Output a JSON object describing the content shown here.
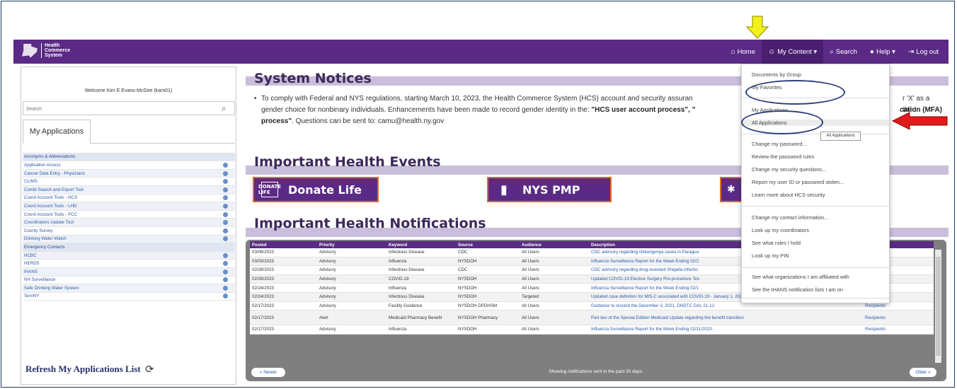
{
  "header": {
    "logo_text": "Health Commerce System",
    "nav": [
      {
        "icon": "home-icon",
        "label": "Home"
      },
      {
        "icon": "user-icon",
        "label": "My Content ▾"
      },
      {
        "icon": "search-icon",
        "label": "Search"
      },
      {
        "icon": "help-icon",
        "label": "Help ▾"
      },
      {
        "icon": "logout-icon",
        "label": "Log out"
      }
    ]
  },
  "sidebar": {
    "welcome": "Welcome Kim E Evans-McGee (kam01)",
    "search_placeholder": "Search",
    "tab_label": "My Applications",
    "apps": [
      "Acronyms & Abbreviations",
      "Application Access",
      "Cancer Data Entry - Physicians",
      "CLIMS",
      "Combi Search and Export Tool",
      "Coord Account Tools - HCS",
      "Coord Account Tools - LHD",
      "Coord Account Tools - PCC",
      "Coordinators Update Tool",
      "County Survey",
      "Drinking Water Watch",
      "Emergency Contacts",
      "HCBC",
      "HERDS",
      "IHANS",
      "NH Surveillance",
      "Safe Drinking Water System",
      "ServNY"
    ],
    "refresh_label": "Refresh My Applications List"
  },
  "main": {
    "system_notices_title": "System Notices",
    "notice_text_1": "To comply with Federal and NYS regulations, starting March 10, 2023, the Health Commerce System (HCS) account and security assuran",
    "notice_text_1b": "r 'X' as a third",
    "notice_text_2": "gender choice for nonbinary individuals. Enhancements have been made to record gender identity in the: ",
    "notice_bold_1": "\"HCS user account process\", \"",
    "notice_bold_2": "cation (MFA)",
    "notice_text_3_bold": "process\"",
    "notice_text_3": ". Questions can be sent to: camu@health.ny.gov",
    "health_events_title": "Important Health Events",
    "banners": [
      "Donate Life",
      "NYS PMP"
    ],
    "banner_icons": [
      "DONATE LIFE",
      "▮"
    ],
    "notifications_title": "Important Health Notifications",
    "table": {
      "columns": [
        "Posted",
        "Priority",
        "Keyword",
        "Source",
        "Audience",
        "Description",
        "nts"
      ],
      "rows": [
        [
          "03/06/2023",
          "Advisory",
          "Infectious Disease",
          "CDC",
          "All Users",
          "CDC advisory regarding chikungunya cases in Paragua",
          "nts"
        ],
        [
          "03/03/2023",
          "Advisory",
          "Influenza",
          "NYSDOH",
          "All Users",
          "Influenza Surveillance Report for the Week Ending 02/2",
          "nts"
        ],
        [
          "02/28/2023",
          "Advisory",
          "Infectious Disease",
          "CDC",
          "All Users",
          "CDC advisory regarding drug-resistant Shigella infectio",
          "nts"
        ],
        [
          "02/28/2023",
          "Advisory",
          "COVID-19",
          "NYSDOH",
          "All Users",
          "Updated COVID-19 Elective Surgery Pre-procedure Tes",
          "nts"
        ],
        [
          "02/24/2023",
          "Advisory",
          "Influenza",
          "NYSDOH",
          "All Users",
          "Influenza Surveillance Report for the Week Ending 02/1",
          "nts"
        ],
        [
          "02/24/2023",
          "Advisory",
          "Infectious Disease",
          "NYSDOH",
          "Targeted",
          "Updated case definition for MIS-C associated with COVID-19 - January 1, 2023",
          "Recipients"
        ],
        [
          "02/17/2023",
          "Advisory",
          "Facility Guidance",
          "NYSDOH DPDHSM",
          "All Users",
          "Guidance to rescind the December 3, 2021, DHDTC DAL 21-12",
          "Recipients"
        ],
        [
          "02/17/2023",
          "Alert",
          "Medicaid Pharmacy Benefit",
          "NYSDOH Pharmacy",
          "All Users",
          "Part two of the Special Edition Medicaid Update regarding the benefit transition",
          "Recipients"
        ],
        [
          "02/17/2023",
          "Advisory",
          "Influenza",
          "NYSDOH",
          "All Users",
          "Influenza Surveillance Report for the Week Ending 02/11/2023.",
          "Recipients"
        ]
      ]
    },
    "newer_label": "« Newer",
    "older_label": "Older »",
    "showing_text": "Showing notifications sent in the past 30 days."
  },
  "dropdown": {
    "items": [
      "Documents by Group",
      "My Favorites",
      "My Applications",
      "All Applications",
      "Change my password...",
      "Review the password rules",
      "Change my security questions...",
      "Report my user ID or password stolen...",
      "Learn more about HCS security",
      "Change my contact information...",
      "Look up my coordinators",
      "See what roles I hold",
      "Look up my PIN",
      "See what organizations I am affiliated with",
      "See the IHANS notification lists I am on"
    ],
    "tooltip": "All Applications"
  },
  "colors": {
    "brand_purple": "#5b2a86",
    "accent_orange": "#e36b1e",
    "annotation_yellow": "#f2f21a",
    "annotation_red": "#e01b1b",
    "annotation_ellipse": "#2c3f7a"
  }
}
